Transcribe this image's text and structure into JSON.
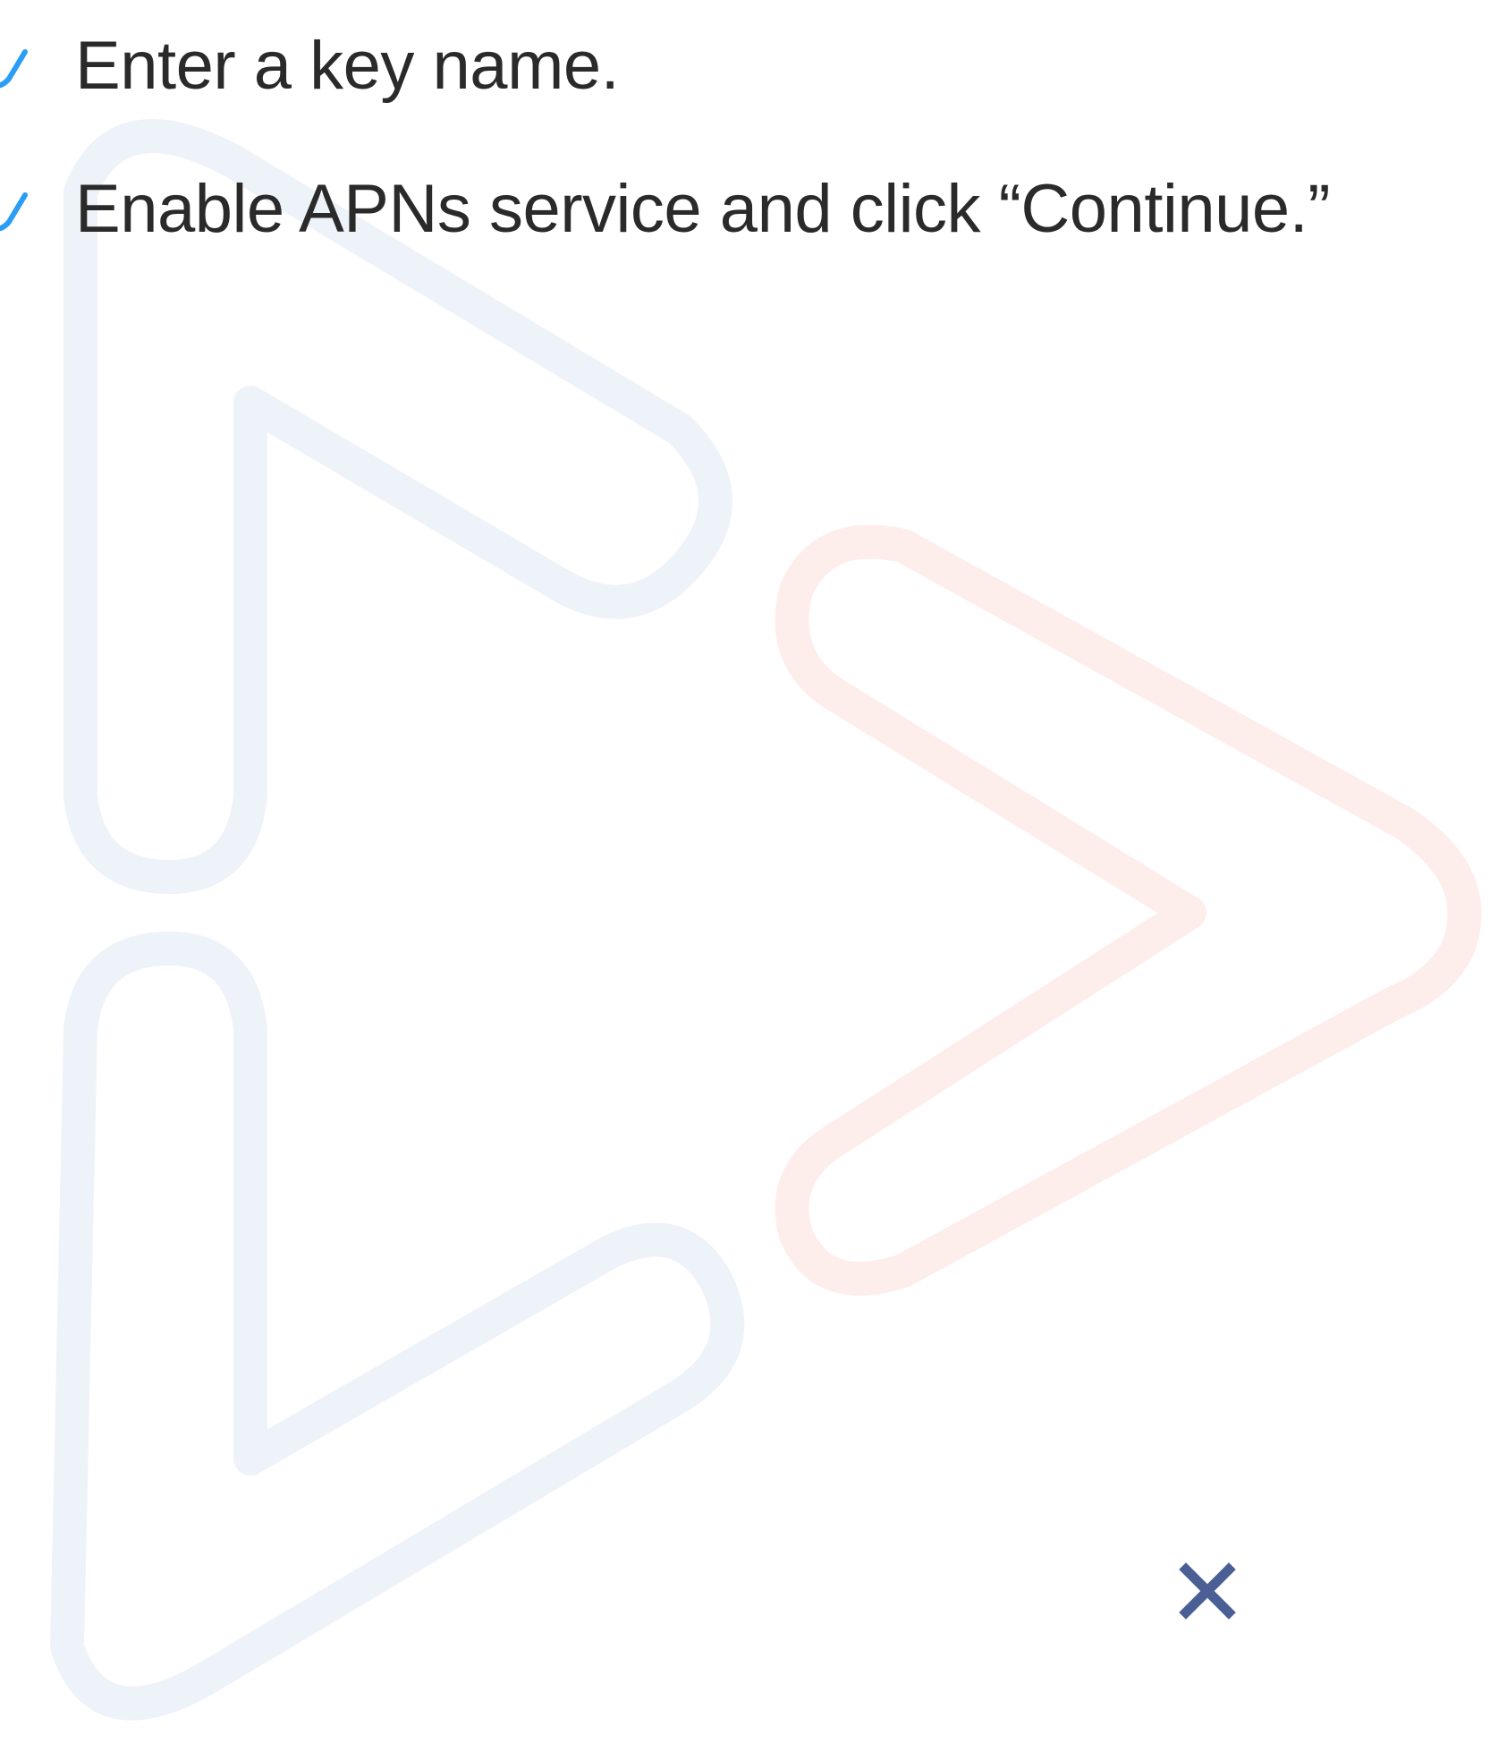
{
  "steps": [
    {
      "text": "Enter a key name."
    },
    {
      "text": "Enable APNs service and click “Continue.”"
    }
  ],
  "icons": {
    "step_check": "check-icon",
    "close": "close-icon",
    "background": "logo-watermark"
  },
  "colors": {
    "check_blue": "#2a9df4",
    "close_navy": "#4a5f93",
    "watermark_blue": "#eef3fa",
    "watermark_red": "#fdeeec",
    "text": "#2a2a2a"
  }
}
